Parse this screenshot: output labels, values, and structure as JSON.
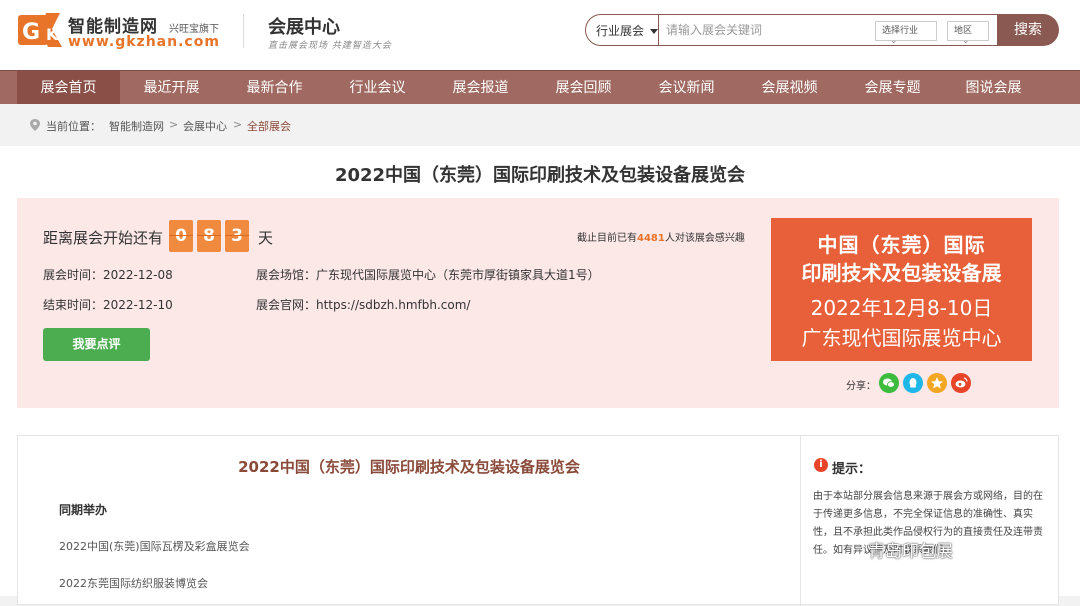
{
  "header": {
    "logo_initials": "GK",
    "logo_name": "智能制造网",
    "logo_tagline": "兴旺宝旗下",
    "logo_url": "www.gkzhan.com",
    "section_title": "会展中心",
    "section_slogan": "直击展会现场 共建智造大会"
  },
  "search": {
    "category": "行业展会",
    "placeholder": "请输入展会关键词",
    "filter_industry": "选择行业",
    "filter_region": "地区",
    "button": "搜索"
  },
  "nav": {
    "items": [
      "展会首页",
      "最近开展",
      "最新合作",
      "行业会议",
      "展会报道",
      "展会回顾",
      "会议新闻",
      "会展视频",
      "会展专题",
      "图说会展"
    ]
  },
  "breadcrumb": {
    "label": "当前位置：",
    "items": [
      "智能制造网",
      "会展中心",
      "全部展会"
    ],
    "separator": ">"
  },
  "expo": {
    "title": "2022中国（东莞）国际印刷技术及包装设备展览会",
    "countdown_label": "距离展会开始还有",
    "countdown_digits": [
      "0",
      "8",
      "3"
    ],
    "countdown_unit": "天",
    "interest_prefix": "截止目前已有",
    "interest_count": "4481",
    "interest_suffix": "人对该展会感兴趣",
    "start_date": "展会时间：2022-12-08",
    "end_date": "结束时间：2022-12-10",
    "venue": "展会场馆：广东现代国际展览中心（东莞市厚街镇家具大道1号）",
    "website": "展会官网：https://sdbzh.hmfbh.com/",
    "review_button": "我要点评",
    "share_label": "分享："
  },
  "banner": {
    "line1": "中国（东莞）国际",
    "line2": "印刷技术及包装设备展",
    "line3": "2022年12月8-10日",
    "line4": "广东现代国际展览中心"
  },
  "detail": {
    "title": "2022中国（东莞）国际印刷技术及包装设备展览会",
    "same_time_heading": "同期举办",
    "co_expos": [
      "2022中国(东莞)国际瓦楞及彩盒展览会",
      "2022东莞国际纺织服装博览会"
    ]
  },
  "tip": {
    "icon": "i",
    "title": "提示：",
    "text": "由于本站部分展会信息来源于展会方或网络，目的在于传递更多信息，不完全保证信息的准确性、真实性，且不承担此类作品侵权行为的直接责任及连带责任。如有异议请及时联系我们。"
  },
  "watermark": "青岛印包展",
  "colors": {
    "nav_bg": "#a06a62",
    "nav_active": "#8a5048",
    "accent_orange": "#f08a3e",
    "banner_bg": "#e8603a",
    "button_green": "#4cad50",
    "panel_pink": "#fde8e8"
  }
}
